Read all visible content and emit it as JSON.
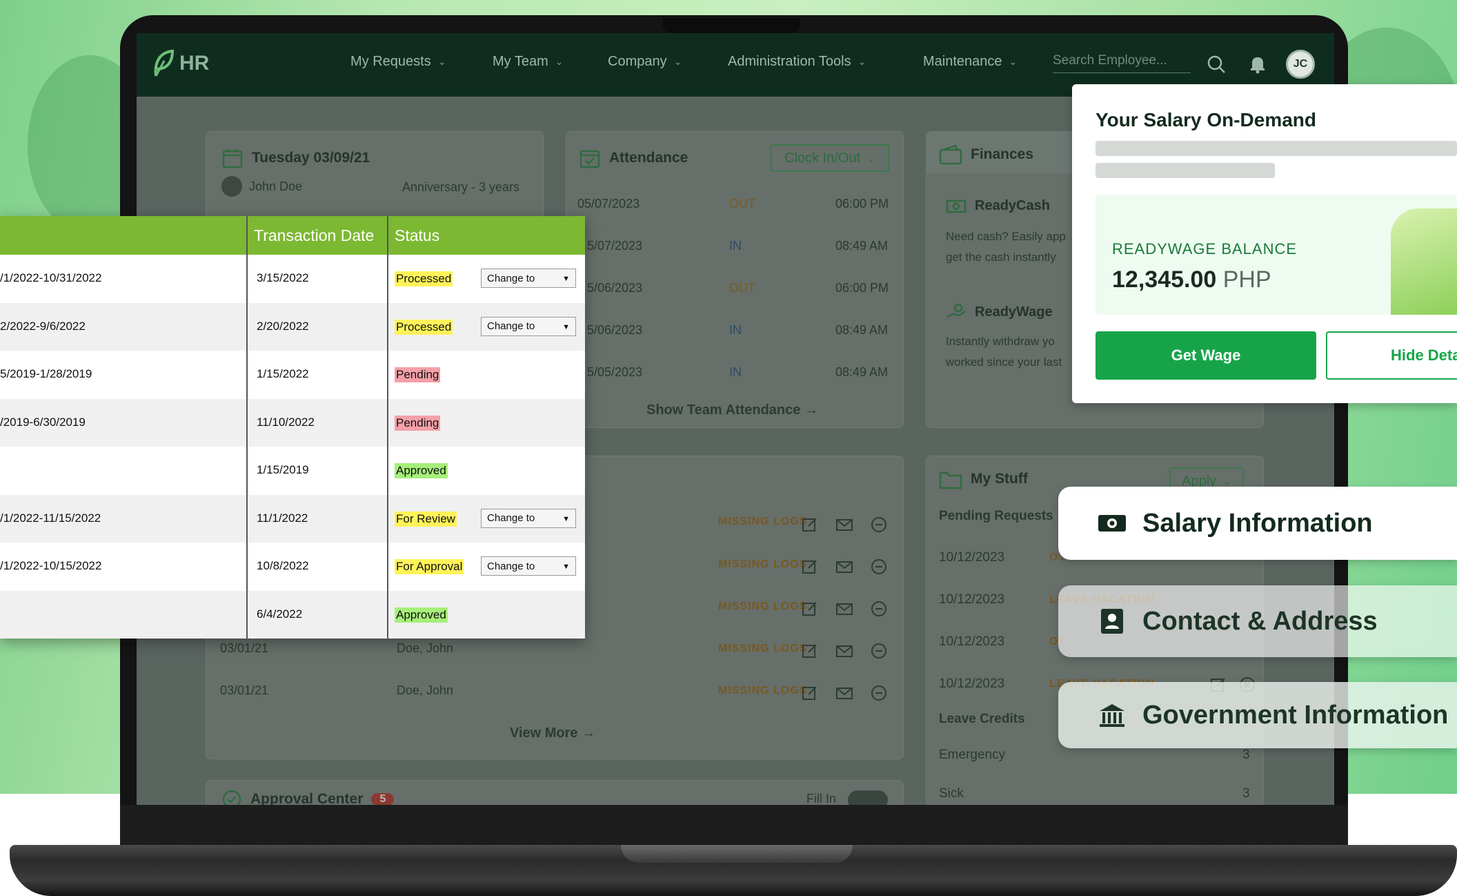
{
  "app": {
    "logo_text": "HR"
  },
  "nav": {
    "items": [
      {
        "label": "My Requests"
      },
      {
        "label": "My Team"
      },
      {
        "label": "Company"
      },
      {
        "label": "Administration Tools"
      },
      {
        "label": "Maintenance"
      }
    ],
    "search_placeholder": "Search Employee...",
    "avatar_initials": "JC"
  },
  "calendar_card": {
    "title": "Tuesday 03/09/21",
    "events": [
      {
        "name": "John Doe",
        "event": "Anniversary - 3 years"
      }
    ]
  },
  "attendance": {
    "title": "Attendance",
    "clock_button": "Clock In/Out",
    "rows": [
      {
        "date": "05/07/2023",
        "type": "OUT",
        "time": "06:00 PM"
      },
      {
        "date": "5/07/2023",
        "type": "IN",
        "time": "08:49 AM"
      },
      {
        "date": "5/06/2023",
        "type": "OUT",
        "time": "06:00 PM"
      },
      {
        "date": "5/06/2023",
        "type": "IN",
        "time": "08:49 AM"
      },
      {
        "date": "5/05/2023",
        "type": "IN",
        "time": "08:49 AM"
      }
    ],
    "show_team_link": "Show Team Attendance"
  },
  "logs": {
    "rows": [
      {
        "date": "",
        "name": "",
        "status": "MISSING LOGS"
      },
      {
        "date": "",
        "name": "",
        "status": "MISSING LOGS"
      },
      {
        "date": "",
        "name": "",
        "status": "MISSING LOGS"
      },
      {
        "date": "03/01/21",
        "name": "Doe, John",
        "status": "MISSING LOGS"
      },
      {
        "date": "03/01/21",
        "name": "Doe, John",
        "status": "MISSING LOGS"
      }
    ],
    "view_more": "View More"
  },
  "approval_center": {
    "title": "Approval Center",
    "badge": "5",
    "fill_in_label": "Fill In"
  },
  "finances": {
    "title": "Finances",
    "readycash": {
      "title": "ReadyCash",
      "desc_line1": "Need cash? Easily app",
      "desc_line2": "get the cash instantly"
    },
    "readywage": {
      "title": "ReadyWage",
      "desc_line1": "Instantly withdraw yo",
      "desc_line2": "worked since your last"
    }
  },
  "my_stuff": {
    "title": "My Stuff",
    "apply_button": "Apply",
    "pending_label": "Pending Requests",
    "requests": [
      {
        "date": "10/12/2023",
        "type": "OT"
      },
      {
        "date": "10/12/2023",
        "type": "LEAVE-VACATION"
      },
      {
        "date": "10/12/2023",
        "type": "OT"
      },
      {
        "date": "10/12/2023",
        "type": "LEAVE-VACATION"
      }
    ],
    "leave_credits_label": "Leave Credits",
    "leave_credits": [
      {
        "type": "Emergency",
        "count": "3"
      },
      {
        "type": "Sick",
        "count": "3"
      }
    ]
  },
  "transactions": {
    "headers": [
      "Transaction Date",
      "Status"
    ],
    "rows": [
      {
        "period": "/1/2022-10/31/2022",
        "date": "3/15/2022",
        "status": "Processed",
        "action": "Change to"
      },
      {
        "period": "2/2022-9/6/2022",
        "date": "2/20/2022",
        "status": "Processed",
        "action": "Change to"
      },
      {
        "period": "5/2019-1/28/2019",
        "date": "1/15/2022",
        "status": "Pending",
        "action": ""
      },
      {
        "period": "/2019-6/30/2019",
        "date": "11/10/2022",
        "status": "Pending",
        "action": ""
      },
      {
        "period": "",
        "date": "1/15/2019",
        "status": "Approved",
        "action": ""
      },
      {
        "period": "/1/2022-11/15/2022",
        "date": "11/1/2022",
        "status": "For Review",
        "action": "Change to"
      },
      {
        "period": "/1/2022-10/15/2022",
        "date": "10/8/2022",
        "status": "For Approval",
        "action": "Change to"
      },
      {
        "period": "",
        "date": "6/4/2022",
        "status": "Approved",
        "action": ""
      }
    ]
  },
  "salary_on_demand": {
    "title": "Your Salary On-Demand",
    "balance_label": "READYWAGE BALANCE",
    "balance_amount": "12,345.00",
    "currency": "PHP",
    "get_wage_button": "Get Wage",
    "hide_details_button": "Hide Deta"
  },
  "info_pills": {
    "salary": "Salary Information",
    "contact": "Contact & Address",
    "government": "Government Information"
  },
  "colors": {
    "header_bg": "#0f2d1f",
    "brand_green": "#17a449",
    "table_header": "#7cb832"
  }
}
